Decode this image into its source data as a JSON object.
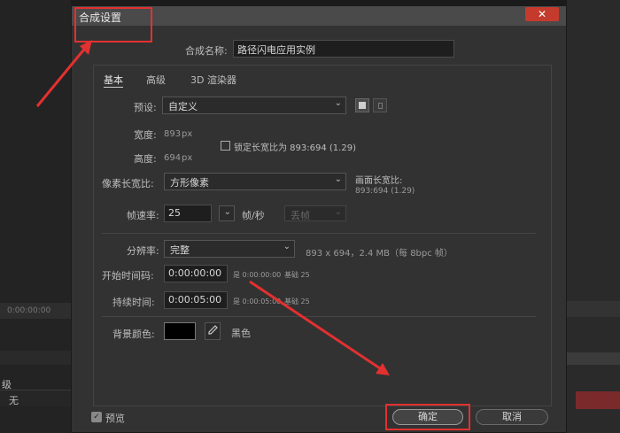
{
  "background": {
    "timecode": "0:00:00:00",
    "level_label": "级",
    "level_value": "无"
  },
  "dialog": {
    "title": "合成设置",
    "close": "✕",
    "comp_name_label": "合成名称:",
    "comp_name_value": "路径闪电应用实例",
    "tabs": [
      "基本",
      "高级",
      "3D 渲染器"
    ],
    "preset_label": "预设:",
    "preset_value": "自定义",
    "width_label": "宽度:",
    "width_value": "893",
    "height_label": "高度:",
    "height_value": "694",
    "px": "px",
    "lock_label": "锁定长宽比为 893:694 (1.29)",
    "pixel_aspect_label": "像素长宽比:",
    "pixel_aspect_value": "方形像素",
    "frame_aspect_label": "画面长宽比:",
    "frame_aspect_value": "893:694 (1.29)",
    "fps_label": "帧速率:",
    "fps_value": "25",
    "fps_unit": "帧/秒",
    "drop_frame": "丢帧",
    "resolution_label": "分辨率:",
    "resolution_value": "完整",
    "resolution_info": "893 x 694，2.4 MB（每 8bpc 帧）",
    "start_tc_label": "开始时间码:",
    "start_tc_value": "0:00:00:00",
    "start_tc_info": "是 0:00:00:00",
    "start_base": "基础 25",
    "duration_label": "持续时间:",
    "duration_value": "0:00:05:00",
    "duration_info": "是 0:00:05:00",
    "duration_base": "基础 25",
    "bg_color_label": "背景颜色:",
    "bg_color_name": "黑色",
    "preview_label": "预览",
    "ok_label": "确定",
    "cancel_label": "取消"
  },
  "colors": {
    "annotation": "#e33030",
    "close": "#c43b2e",
    "accent_blue": "#3b8fd6",
    "bg_swatch": "#000000"
  }
}
